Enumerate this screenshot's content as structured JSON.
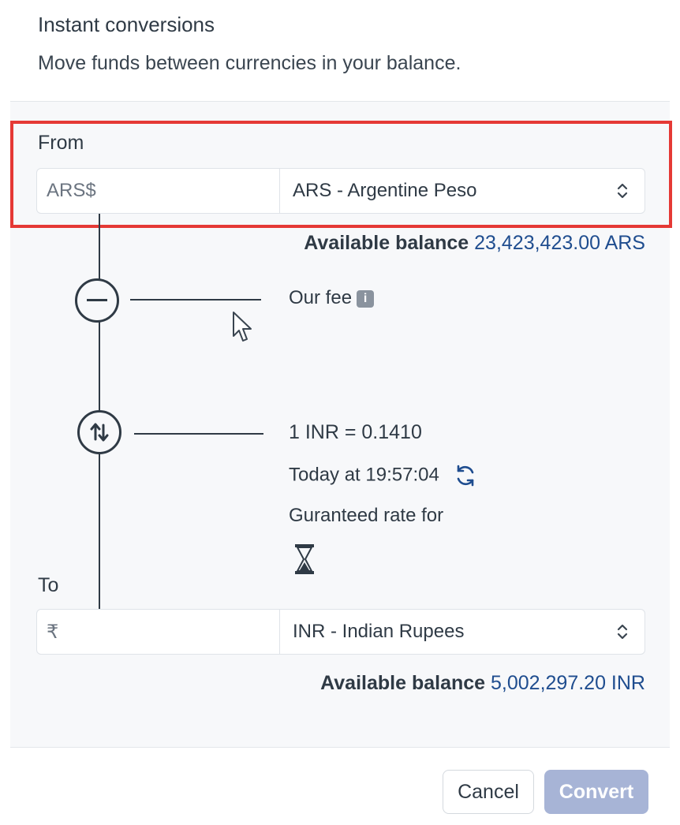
{
  "header": {
    "title": "Instant conversions",
    "subtitle": "Move funds between currencies in your balance."
  },
  "from": {
    "label": "From",
    "amount_placeholder": "ARS$",
    "currency": "ARS - Argentine Peso",
    "balance_label": "Available balance",
    "balance_value": "23,423,423.00 ARS"
  },
  "fee": {
    "label": "Our fee",
    "icon": "info-icon"
  },
  "rate": {
    "value": "1 INR = 0.1410",
    "timestamp": "Today at 19:57:04",
    "guaranteed_label": "Guranteed rate for",
    "refresh_icon": "refresh-icon",
    "timer_icon": "hourglass-icon"
  },
  "to": {
    "label": "To",
    "amount_placeholder": "₹",
    "currency": "INR - Indian Rupees",
    "balance_label": "Available balance",
    "balance_value": "5,002,297.20 INR"
  },
  "actions": {
    "cancel": "Cancel",
    "convert": "Convert"
  },
  "colors": {
    "highlight": "#e53935",
    "link_value": "#1f4d8f",
    "convert_disabled": "#a7b4d6"
  }
}
